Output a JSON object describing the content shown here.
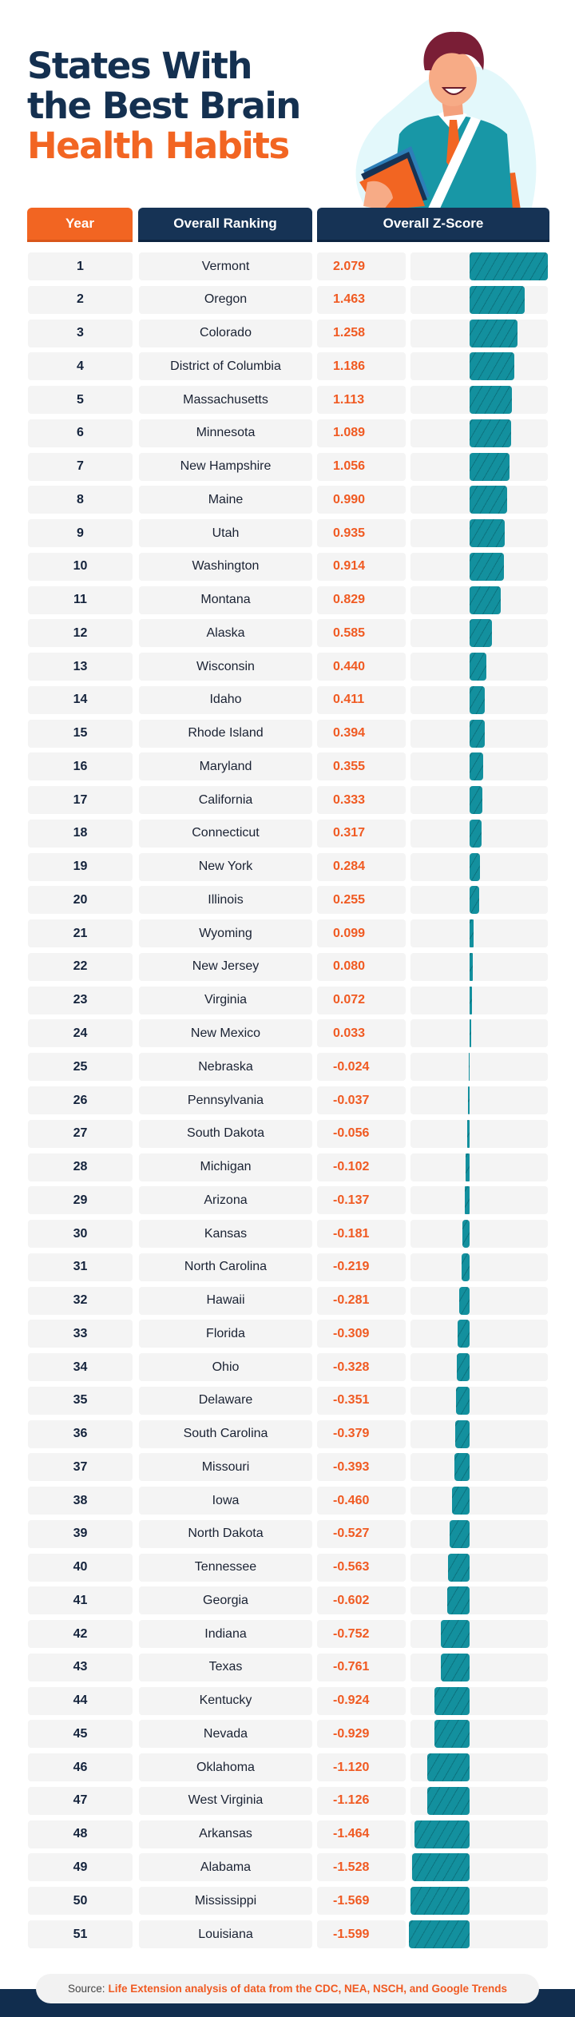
{
  "title": {
    "line1": "States With",
    "line2": "the Best Brain",
    "line3": "Health Habits"
  },
  "illustration": "student-holding-books-icon",
  "colors": {
    "navy": "#163355",
    "orange": "#f26522",
    "teal": "#13909e",
    "row_bg": "#f4f4f4"
  },
  "table": {
    "headers": [
      "Year",
      "Overall Ranking",
      "Overall Z-Score"
    ]
  },
  "chart_data": {
    "type": "bar",
    "title": "States With the Best Brain Health Habits",
    "xlabel": "Overall Z-Score",
    "ylabel": "Overall Ranking",
    "orientation": "horizontal",
    "xlim": [
      -1.6,
      2.1
    ],
    "grid": false,
    "categories": [
      "Vermont",
      "Oregon",
      "Colorado",
      "District of Columbia",
      "Massachusetts",
      "Minnesota",
      "New Hampshire",
      "Maine",
      "Utah",
      "Washington",
      "Montana",
      "Alaska",
      "Wisconsin",
      "Idaho",
      "Rhode Island",
      "Maryland",
      "California",
      "Connecticut",
      "New York",
      "Illinois",
      "Wyoming",
      "New Jersey",
      "Virginia",
      "New Mexico",
      "Nebraska",
      "Pennsylvania",
      "South Dakota",
      "Michigan",
      "Arizona",
      "Kansas",
      "North Carolina",
      "Hawaii",
      "Florida",
      "Ohio",
      "Delaware",
      "South Carolina",
      "Missouri",
      "Iowa",
      "North Dakota",
      "Tennessee",
      "Georgia",
      "Indiana",
      "Texas",
      "Kentucky",
      "Nevada",
      "Oklahoma",
      "West Virginia",
      "Arkansas",
      "Alabama",
      "Mississippi",
      "Louisiana"
    ],
    "ranks": [
      1,
      2,
      3,
      4,
      5,
      6,
      7,
      8,
      9,
      10,
      11,
      12,
      13,
      14,
      15,
      16,
      17,
      18,
      19,
      20,
      21,
      22,
      23,
      24,
      25,
      26,
      27,
      28,
      29,
      30,
      31,
      32,
      33,
      34,
      35,
      36,
      37,
      38,
      39,
      40,
      41,
      42,
      43,
      44,
      45,
      46,
      47,
      48,
      49,
      50,
      51
    ],
    "values": [
      2.079,
      1.463,
      1.258,
      1.186,
      1.113,
      1.089,
      1.056,
      0.99,
      0.935,
      0.914,
      0.829,
      0.585,
      0.44,
      0.411,
      0.394,
      0.355,
      0.333,
      0.317,
      0.284,
      0.255,
      0.099,
      0.08,
      0.072,
      0.033,
      -0.024,
      -0.037,
      -0.056,
      -0.102,
      -0.137,
      -0.181,
      -0.219,
      -0.281,
      -0.309,
      -0.328,
      -0.351,
      -0.379,
      -0.393,
      -0.46,
      -0.527,
      -0.563,
      -0.602,
      -0.752,
      -0.761,
      -0.924,
      -0.929,
      -1.12,
      -1.126,
      -1.464,
      -1.528,
      -1.569,
      -1.599
    ],
    "value_labels": [
      "2.079",
      "1.463",
      "1.258",
      "1.186",
      "1.113",
      "1.089",
      "1.056",
      "0.990",
      "0.935",
      "0.914",
      "0.829",
      "0.585",
      "0.440",
      "0.411",
      "0.394",
      "0.355",
      "0.333",
      "0.317",
      "0.284",
      "0.255",
      "0.099",
      "0.080",
      "0.072",
      "0.033",
      "-0.024",
      "-0.037",
      "-0.056",
      "-0.102",
      "-0.137",
      "-0.181",
      "-0.219",
      "-0.281",
      "-0.309",
      "-0.328",
      "-0.351",
      "-0.379",
      "-0.393",
      "-0.460",
      "-0.527",
      "-0.563",
      "-0.602",
      "-0.752",
      "-0.761",
      "-0.924",
      "-0.929",
      "-1.120",
      "-1.126",
      "-1.464",
      "-1.528",
      "-1.569",
      "-1.599"
    ]
  },
  "footer": {
    "source_label": "Source:",
    "source_text": "Life Extension analysis of data from the CDC, NEA, NSCH, and Google Trends"
  }
}
